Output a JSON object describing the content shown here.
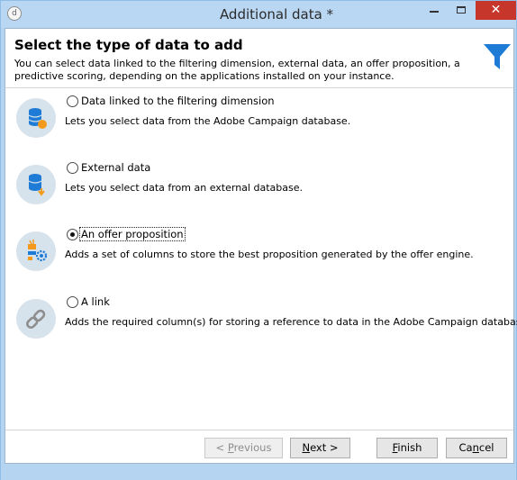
{
  "window": {
    "title": "Additional data *",
    "app_icon_glyph": "d",
    "close_glyph": "✕"
  },
  "header": {
    "title": "Select the type of data to add",
    "description": "You can select data linked to the filtering dimension, external data, an offer proposition, a predictive scoring, depending on the applications installed on your instance.",
    "icon": "funnel-icon"
  },
  "options": [
    {
      "label": "Data linked to the filtering dimension",
      "description": "Lets you select data from the Adobe Campaign database.",
      "icon": "database-icon",
      "selected": false
    },
    {
      "label": "External data",
      "description": "Lets you select data from an external database.",
      "icon": "external-database-icon",
      "selected": false
    },
    {
      "label": "An offer proposition",
      "description": "Adds a set of columns to store the best proposition generated by the offer engine.",
      "icon": "offer-icon",
      "selected": true
    },
    {
      "label": "A link",
      "description": "Adds the required column(s) for storing a reference to data in the Adobe Campaign database.",
      "icon": "link-icon",
      "selected": false
    }
  ],
  "buttons": {
    "previous_prefix": "< ",
    "previous_underlined": "P",
    "previous_rest": "revious",
    "next_underlined": "N",
    "next_rest": "ext >",
    "finish_underlined": "F",
    "finish_rest": "inish",
    "cancel_prefix": "Ca",
    "cancel_underlined": "n",
    "cancel_rest": "cel"
  },
  "colors": {
    "accent_blue": "#1e7bd6",
    "icon_circle": "#d6e2ec",
    "close_red": "#c7362b",
    "orange": "#f39a1c"
  }
}
